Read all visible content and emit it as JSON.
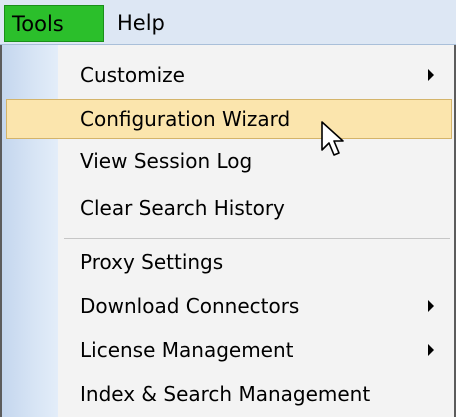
{
  "menubar": {
    "tools_label": "Tools",
    "help_label": "Help"
  },
  "dropdown": {
    "items": [
      {
        "label": "Customize",
        "has_submenu": true
      },
      {
        "label": "Configuration Wizard",
        "highlighted": true
      },
      {
        "label": "View Session Log"
      },
      {
        "label": "Clear Search History"
      },
      {
        "label": "Proxy Settings"
      },
      {
        "label": "Download Connectors",
        "has_submenu": true
      },
      {
        "label": "License Management",
        "has_submenu": true
      },
      {
        "label": "Index & Search Management"
      }
    ]
  },
  "colors": {
    "active_menu": "#2bbf2b",
    "highlight": "#fbe5ad",
    "gutter": "#c4d6ee"
  },
  "icons": {
    "submenu": "chevron-right-icon",
    "pointer": "mouse-pointer-icon"
  }
}
